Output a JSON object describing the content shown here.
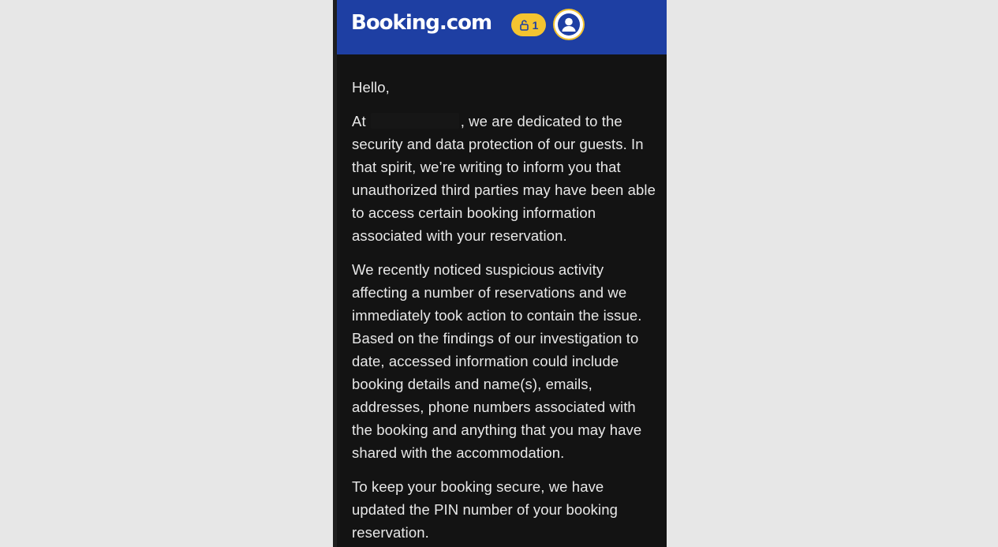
{
  "header": {
    "logo_text": "Booking.com",
    "notification_count": "1",
    "notification_icon": "lock-open-icon",
    "avatar_icon": "user-avatar-icon",
    "brand_color": "#1e3fa3",
    "accent_color": "#f4c430"
  },
  "email": {
    "greeting": "Hello,",
    "paragraph1": {
      "lead": "At",
      "rest": ", we are dedicated to the",
      "lines": [
        "security and data protection of our guests. In",
        "that spirit, we’re writing to inform you that",
        "unauthorized third parties may have been able",
        "to access certain booking information",
        "associated with your reservation."
      ]
    },
    "paragraph2": {
      "lines": [
        "We recently noticed suspicious activity",
        "affecting a number of reservations and we",
        "immediately took action to contain the issue.",
        "Based on the findings of our investigation to",
        "date, accessed information could include",
        "booking details and name(s), emails,",
        "addresses, phone numbers associated with",
        "the booking and anything that you may have",
        "shared with the accommodation."
      ]
    },
    "paragraph3": {
      "lines": [
        "To keep your booking secure, we have",
        "updated the PIN number of your booking",
        "reservation."
      ]
    }
  }
}
